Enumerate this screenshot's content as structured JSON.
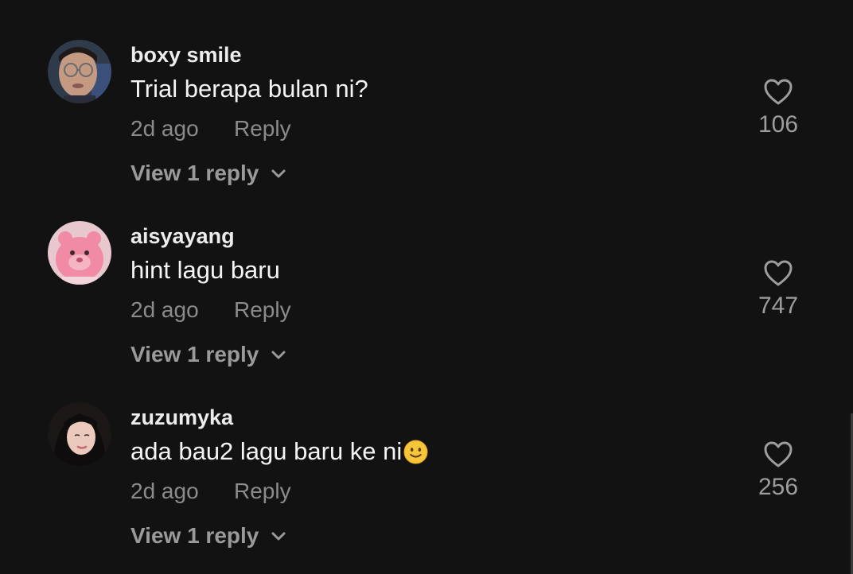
{
  "colors": {
    "background": "#121212",
    "username": "#ececec",
    "text": "#f4f4f4",
    "muted": "#8b8b8b"
  },
  "comments": [
    {
      "username": "boxy smile",
      "text": "Trial berapa bulan ni?",
      "time": "2d ago",
      "reply_label": "Reply",
      "view_replies_label": "View 1 reply",
      "likes": "106",
      "avatar_icon": "avatar-man-with-glasses"
    },
    {
      "username": "aisyayang",
      "text": "hint lagu baru",
      "time": "2d ago",
      "reply_label": "Reply",
      "view_replies_label": "View 1 reply",
      "likes": "747",
      "avatar_icon": "avatar-pink-plush"
    },
    {
      "username": "zuzumyka",
      "text": "ada bau2 lagu baru ke ni",
      "emoji": "slightly-smiling-face",
      "time": "2d ago",
      "reply_label": "Reply",
      "view_replies_label": "View 1 reply",
      "likes": "256",
      "avatar_icon": "avatar-woman-portrait"
    }
  ]
}
